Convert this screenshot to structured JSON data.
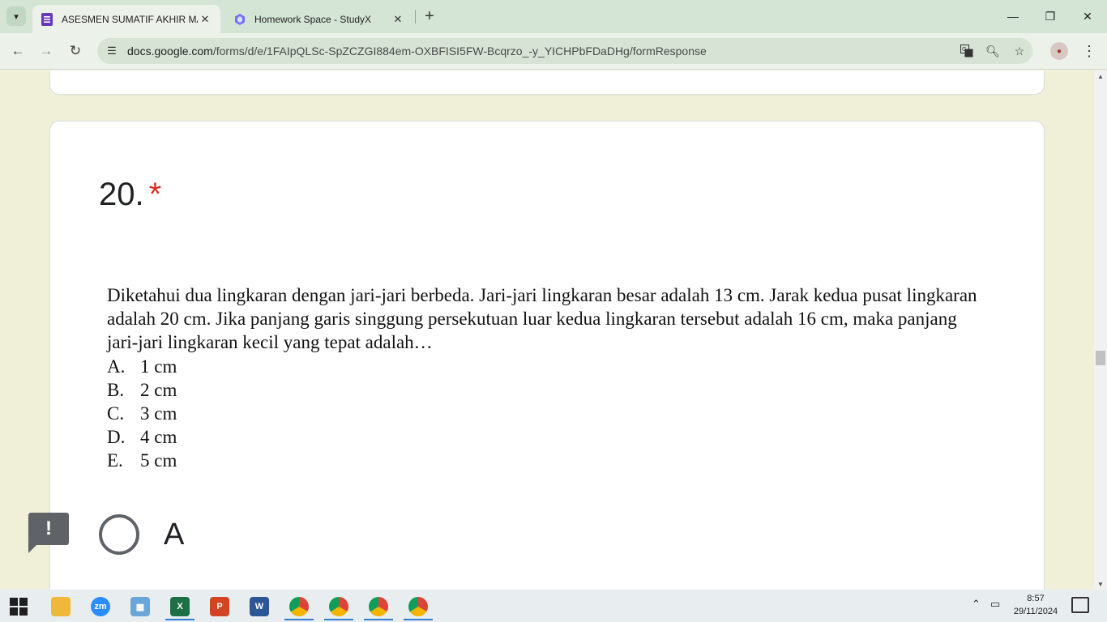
{
  "browser": {
    "tabs": [
      {
        "title": "ASESMEN SUMATIF AKHIR MAT",
        "favicon": "google-forms-icon",
        "active": true
      },
      {
        "title": "Homework Space - StudyX",
        "favicon": "studyx-icon",
        "active": false
      }
    ],
    "url_host": "docs.google.com",
    "url_path": "/forms/d/e/1FAIpQLSc-SpZCZGI884em-OXBFISI5FW-Bcqrzo_-y_YICHPbFDaDHg/formResponse"
  },
  "question": {
    "number": "20.",
    "required_mark": "*",
    "body": "Diketahui dua lingkaran dengan jari-jari berbeda. Jari-jari lingkaran besar adalah 13 cm. Jarak kedua pusat lingkaran adalah 20 cm. Jika panjang garis singgung persekutuan luar kedua lingkaran tersebut adalah 16 cm, maka panjang jari-jari lingkaran kecil yang tepat adalah…",
    "options": [
      {
        "letter": "A.",
        "text": "1 cm"
      },
      {
        "letter": "B.",
        "text": "2 cm"
      },
      {
        "letter": "C.",
        "text": "3 cm"
      },
      {
        "letter": "D.",
        "text": "4 cm"
      },
      {
        "letter": "E.",
        "text": "5 cm"
      }
    ],
    "answer_choice": "A",
    "answer_selected": false
  },
  "taskbar": {
    "apps": [
      "file-explorer-icon",
      "zoom-icon",
      "control-panel-icon",
      "excel-icon",
      "powerpoint-icon",
      "word-icon",
      "chrome-icon",
      "chrome-profile-icon",
      "chrome-profile-d-icon",
      "chrome-profile-w-icon"
    ],
    "time": "8:57",
    "date": "29/11/2024"
  },
  "colors": {
    "page_background": "#f0efd8",
    "required_red": "#d93025",
    "tab_strip": "#d4e4d5",
    "toolbar": "#ecf2ea"
  }
}
